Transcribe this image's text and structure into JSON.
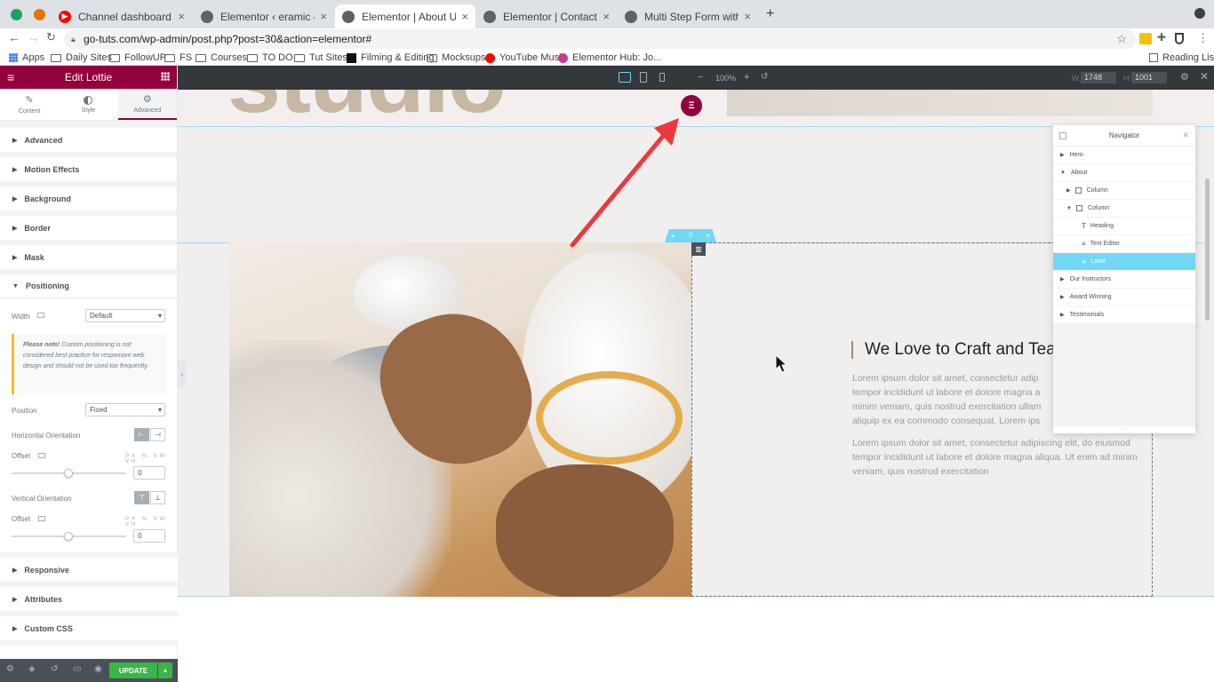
{
  "browser": {
    "tabs": [
      {
        "title": "Channel dashboard - YouTube",
        "favicon_color": "#ff0000"
      },
      {
        "title": "Elementor ‹ eramic — WordPress",
        "favicon_color": "#5f6368"
      },
      {
        "title": "Elementor | About Us",
        "favicon_color": "#5f6368",
        "active": true
      },
      {
        "title": "Elementor | Contact Us",
        "favicon_color": "#5f6368"
      },
      {
        "title": "Multi Step Form with Progress",
        "favicon_color": "#5f6368"
      }
    ],
    "url": "go-tuts.com/wp-admin/post.php?post=30&action=elementor#",
    "bookmarks": [
      "Apps",
      "Daily Sites",
      "FollowUP",
      "FS",
      "Courses",
      "TO DO",
      "Tut Sites",
      "Filming & Editing",
      "Mocksups",
      "YouTube Music",
      "Elementor Hub: Jo..."
    ],
    "reading_list": "Reading List"
  },
  "panel": {
    "title": "Edit Lottie",
    "tabs": [
      "Content",
      "Style",
      "Advanced"
    ],
    "sections_top": [
      "Advanced",
      "Motion Effects",
      "Background",
      "Border",
      "Mask"
    ],
    "positioning": {
      "label": "Positioning",
      "width_label": "Width",
      "width_value": "Default",
      "note_bold": "Please note!",
      "note_text": " Custom positioning is not considered best practice for responsive web design and should not be used too frequently.",
      "position_label": "Position",
      "position_value": "Fixed",
      "horizontal_label": "Horizontal Orientation",
      "offset_label": "Offset",
      "units": "PX % VW VH",
      "offset_h_value": "0",
      "vertical_label": "Vertical Orientation",
      "offset_v_value": "0"
    },
    "sections_bottom": [
      "Responsive",
      "Attributes",
      "Custom CSS"
    ],
    "update_label": "UPDATE"
  },
  "topbar": {
    "zoom": "100%",
    "width_label": "W",
    "width_value": "1748",
    "height_label": "H",
    "height_value": "1001"
  },
  "page": {
    "big_word": "studio",
    "heading": "We Love to Craft and Tea",
    "para1": "Lorem ipsum dolor sit amet, consectetur adip tempor incididunt ut labore et dolore magna a minim veniam, quis nostrud exercitation ullam aliquip ex ea commodo consequat. Lorem ips",
    "para2": "Lorem ipsum dolor sit amet, consectetur adipiscing elit, do eiusmod tempor incididunt ut labore et dolore magna aliqua. Ut enim ad minim veniam, quis nostrud exercitation"
  },
  "navigator": {
    "title": "Navigator",
    "items": [
      {
        "label": "Hero",
        "indent": 0
      },
      {
        "label": "About",
        "indent": 0
      },
      {
        "label": "Column",
        "indent": 1
      },
      {
        "label": "Column",
        "indent": 1
      },
      {
        "label": "Heading",
        "indent": 2
      },
      {
        "label": "Text Editor",
        "indent": 2
      },
      {
        "label": "Lottie",
        "indent": 2,
        "selected": true
      },
      {
        "label": "Our Instructors",
        "indent": 0
      },
      {
        "label": "Award Winning",
        "indent": 0
      },
      {
        "label": "Testimonials",
        "indent": 0
      }
    ]
  },
  "colors": {
    "accent": "#93003c",
    "selected": "#71d7f7",
    "update": "#39b54a",
    "arrow": "#f0373b"
  }
}
